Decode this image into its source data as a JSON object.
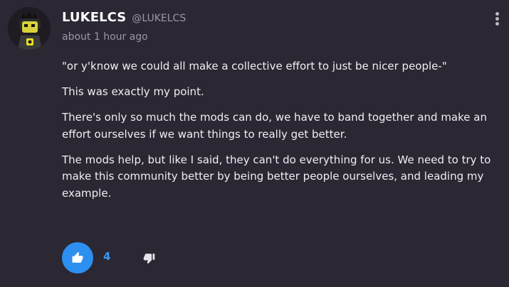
{
  "post": {
    "author": {
      "username": "LUKELCS",
      "handle": "@LUKELCS",
      "avatar_icon": "robot-avatar-icon"
    },
    "timestamp": "about 1 hour ago",
    "menu_icon": "more-vertical-icon",
    "paragraphs": [
      "\"or y'know we could all make a collective effort to just be nicer people-\"",
      "This was exactly my point.",
      "There's only so much the mods can do, we have to band together and make an effort ourselves if we want things to really get better.",
      "The mods help, but like I said, they can't do everything for us. We need to try to make this community better by being better people ourselves, and leading my example."
    ],
    "reactions": {
      "like_icon": "thumbs-up-icon",
      "like_count": "4",
      "dislike_icon": "thumbs-down-icon"
    }
  },
  "colors": {
    "background": "#2b2733",
    "accent": "#2d8ff0",
    "muted_text": "#9b98a3",
    "body_text": "#f0eff3"
  }
}
